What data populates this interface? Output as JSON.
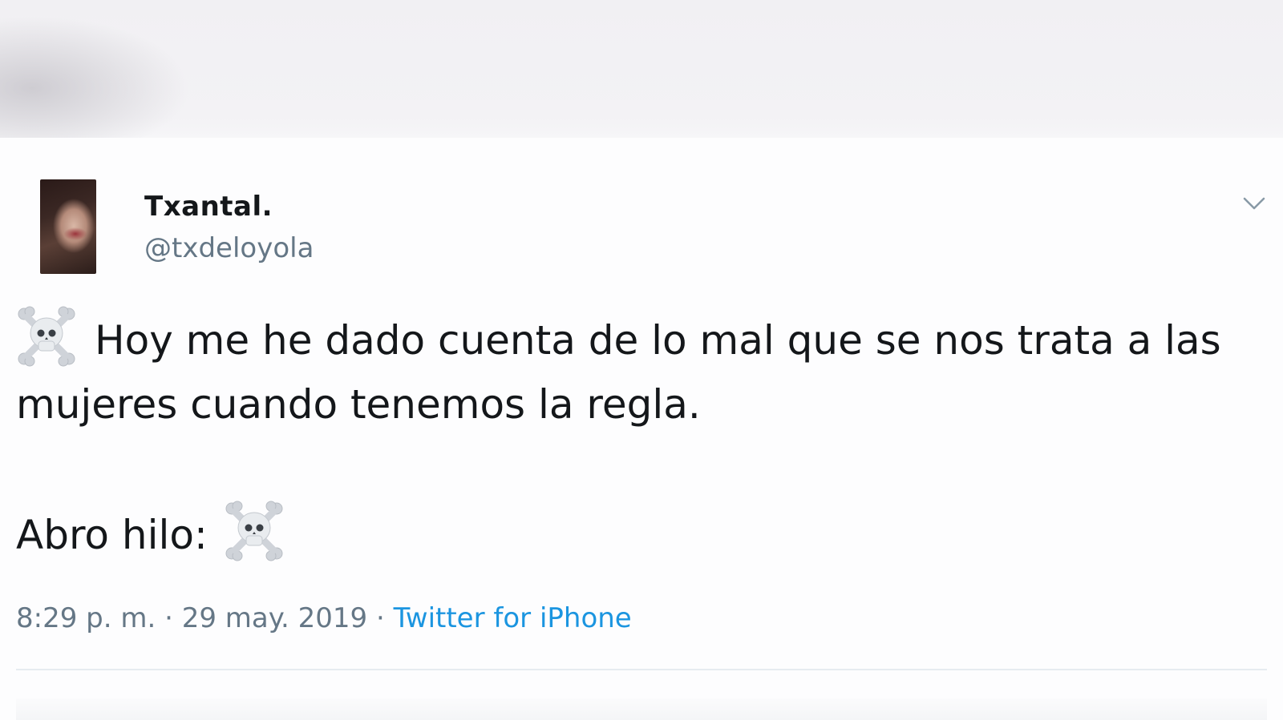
{
  "tweet": {
    "display_name": "Txantal.",
    "handle": "@txdeloyola",
    "text_line1": "Hoy me he dado cuenta de lo mal que se nos trata a las mujeres cuando tenemos la regla.",
    "text_line2": "Abro hilo:",
    "emoji_icon": "skull-and-crossbones-icon",
    "time": "8:29 p. m.",
    "separator": " · ",
    "date": "29 may. 2019",
    "source": "Twitter for iPhone"
  },
  "colors": {
    "text": "#14171a",
    "secondary": "#657786",
    "link": "#1b95e0",
    "divider": "#e6ecf0"
  }
}
